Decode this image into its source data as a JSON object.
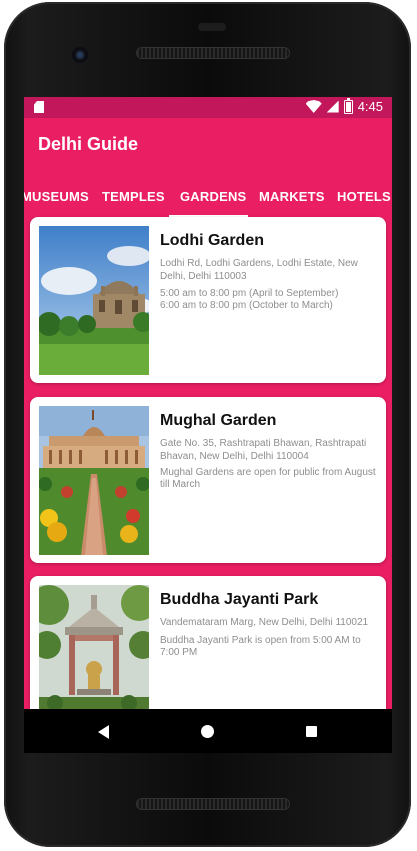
{
  "status": {
    "time": "4:45"
  },
  "app": {
    "title": "Delhi Guide"
  },
  "tabs": [
    "MUSEUMS",
    "TEMPLES",
    "GARDENS",
    "MARKETS",
    "HOTELS"
  ],
  "selected_tab": "GARDENS",
  "places": [
    {
      "name": "Lodhi Garden",
      "address": "Lodhi Rd, Lodhi Gardens, Lodhi Estate, New Delhi, Delhi 110003",
      "hours_line1": "5:00 am to 8:00 pm (April to September)",
      "hours_line2": "6:00 am to 8:00 pm (October to March)"
    },
    {
      "name": "Mughal Garden",
      "address": "Gate No. 35, Rashtrapati Bhawan, Rashtrapati Bhavan, New Delhi, Delhi 110004",
      "hours_line1": "Mughal Gardens are open for public from August till March"
    },
    {
      "name": "Buddha Jayanti Park",
      "address": "Vandemataram Marg, New Delhi, Delhi 110021",
      "hours_line1": "Buddha Jayanti Park is open from 5:00 AM to 7:00 PM"
    }
  ],
  "colors": {
    "primary": "#e91e63",
    "status_bar": "#c2185b",
    "card": "#ffffff",
    "secondary_text": "#8e8e8e"
  },
  "icons": [
    "sd-card-icon",
    "wifi-icon",
    "signal-icon",
    "battery-icon",
    "back-icon",
    "home-icon",
    "recents-icon"
  ]
}
